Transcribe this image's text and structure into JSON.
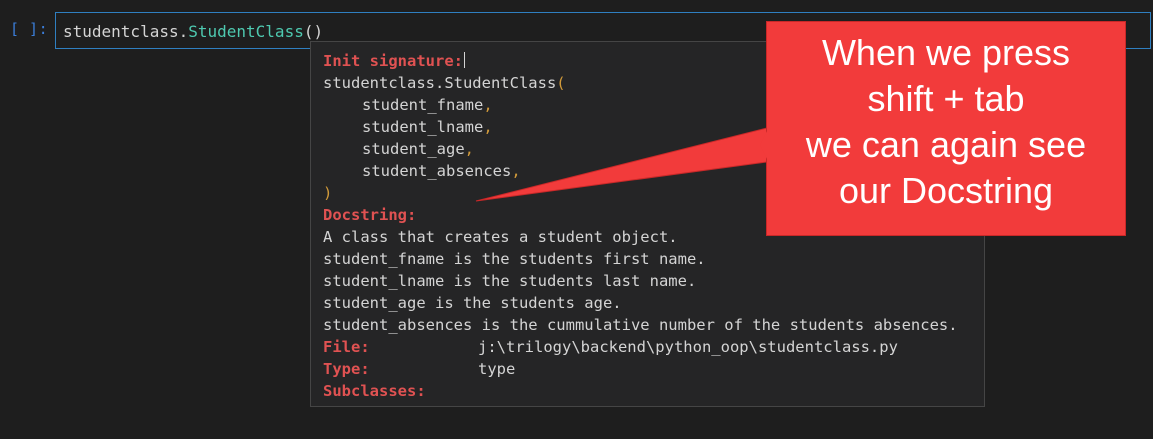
{
  "cell": {
    "prompt": "[ ]:",
    "code": {
      "module": "studentclass",
      "dot": ".",
      "class_name": "StudentClass",
      "parens": "()"
    }
  },
  "tooltip": {
    "init_signature_label": "Init signature:",
    "signature_open": "studentclass.StudentClass",
    "open_paren": "(",
    "params": [
      "student_fname",
      "student_lname",
      "student_age",
      "student_absences"
    ],
    "comma": ",",
    "close_paren": ")",
    "docstring_label": "Docstring:",
    "docstring_lines": [
      "A class that creates a student object.",
      "student_fname is the students first name.",
      "student_lname is the students last name.",
      "student_age is the students age.",
      "student_absences is the cummulative number of the students absences."
    ],
    "file_label": "File:",
    "file_value": "j:\\trilogy\\backend\\python_oop\\studentclass.py",
    "type_label": "Type:",
    "type_value": "type",
    "subclasses_label": "Subclasses:"
  },
  "callout": {
    "lines": [
      "When we press",
      "shift + tab",
      "we can again see",
      "our Docstring"
    ],
    "color": "#f23b3b"
  }
}
